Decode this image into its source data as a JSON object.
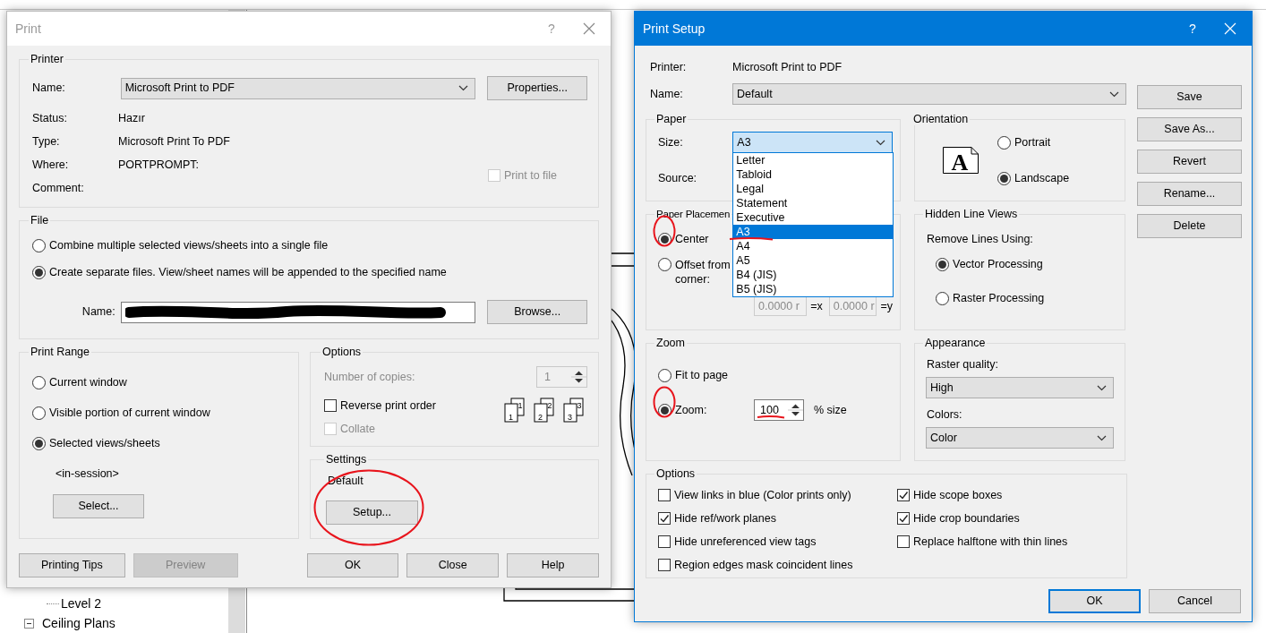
{
  "project_browser": {
    "items": [
      {
        "kind": "view",
        "label": "Level 2"
      },
      {
        "kind": "category",
        "label": "Ceiling Plans",
        "expanded": true
      }
    ]
  },
  "print_dialog": {
    "title": "Print",
    "active": false,
    "help_label": "?",
    "printer": {
      "legend": "Printer",
      "name_label": "Name:",
      "name_value": "Microsoft Print to PDF",
      "properties_button": "Properties...",
      "info": [
        {
          "label": "Status:",
          "value": "Hazır"
        },
        {
          "label": "Type:",
          "value": "Microsoft Print To PDF"
        },
        {
          "label": "Where:",
          "value": "PORTPROMPT:"
        },
        {
          "label": "Comment:"
        }
      ],
      "print_to_file": {
        "label": "Print to file",
        "checked": false,
        "disabled": true
      }
    },
    "file": {
      "legend": "File",
      "options": [
        {
          "label": "Combine multiple selected views/sheets into a single file",
          "selected": false
        },
        {
          "label": "Create separate files. View/sheet names will be appended to the specified name",
          "selected": true
        }
      ],
      "name_label": "Name:",
      "name_redacted": true,
      "browse_button": "Browse..."
    },
    "print_range": {
      "legend": "Print Range",
      "options": [
        {
          "label": "Current window",
          "selected": false
        },
        {
          "label": "Visible portion of current window",
          "selected": false
        },
        {
          "label": "Selected views/sheets",
          "selected": true
        }
      ],
      "selection": "<in-session>",
      "select_button": "Select..."
    },
    "options": {
      "legend": "Options",
      "copies_label": "Number of copies:",
      "copies_value": "1",
      "copies_disabled": true,
      "checks": [
        {
          "label": "Reverse print order",
          "checked": false,
          "disabled": false
        },
        {
          "label": "Collate",
          "checked": false,
          "disabled": true
        }
      ],
      "collate_icons": [
        {
          "back": "1",
          "front": "1"
        },
        {
          "back": "2",
          "front": "2"
        },
        {
          "back": "3",
          "front": "3"
        }
      ]
    },
    "settings": {
      "legend": "Settings",
      "value": "Default",
      "setup_button": "Setup...",
      "circled": true
    },
    "buttons_left": [
      {
        "label": "Printing Tips",
        "disabled": false
      },
      {
        "label": "Preview",
        "disabled": true
      }
    ],
    "buttons_right": [
      {
        "label": "OK",
        "disabled": false
      },
      {
        "label": "Close",
        "disabled": false
      },
      {
        "label": "Help",
        "disabled": false
      }
    ]
  },
  "print_setup": {
    "title": "Print Setup",
    "active": true,
    "help_label": "?",
    "printer_label": "Printer:",
    "printer_value": "Microsoft Print to PDF",
    "name_label": "Name:",
    "name_value": "Default",
    "paper": {
      "legend": "Paper",
      "size_label": "Size:",
      "size_value": "A3",
      "size_focused": true,
      "source_label": "Source:",
      "size_list": {
        "open": true,
        "items": [
          {
            "label": "Letter",
            "selected": false,
            "underlined": false
          },
          {
            "label": "Tabloid",
            "selected": false,
            "underlined": false
          },
          {
            "label": "Legal",
            "selected": false,
            "underlined": false
          },
          {
            "label": "Statement",
            "selected": false,
            "underlined": false
          },
          {
            "label": "Executive",
            "selected": false,
            "underlined": false
          },
          {
            "label": "A3",
            "selected": true,
            "underlined": true
          },
          {
            "label": "A4",
            "selected": false,
            "underlined": false
          },
          {
            "label": "A5",
            "selected": false,
            "underlined": false
          },
          {
            "label": "B4 (JIS)",
            "selected": false,
            "underlined": false
          },
          {
            "label": "B5 (JIS)",
            "selected": false,
            "underlined": false
          }
        ]
      }
    },
    "orientation": {
      "legend": "Orientation",
      "icon_letter": "A",
      "options": [
        {
          "label": "Portrait",
          "selected": false
        },
        {
          "label": "Landscape",
          "selected": true
        }
      ]
    },
    "placement": {
      "legend": "Paper Placemen",
      "options": [
        {
          "label": "Center",
          "selected": true,
          "circled": true
        },
        {
          "label": "Offset from corner:",
          "selected": false,
          "circled": false
        }
      ],
      "offset_x": "0.0000 r",
      "x_suffix": "=x",
      "offset_y": "0.0000 r",
      "y_suffix": "=y",
      "offset_disabled": true
    },
    "hidden_lines": {
      "legend": "Hidden Line Views",
      "label": "Remove Lines Using:",
      "options": [
        {
          "label": "Vector Processing",
          "selected": true
        },
        {
          "label": "Raster Processing",
          "selected": false
        }
      ]
    },
    "zoom": {
      "legend": "Zoom",
      "options": [
        {
          "label": "Fit to page",
          "selected": false,
          "circled": false
        },
        {
          "label": "Zoom:",
          "selected": true,
          "circled": true
        }
      ],
      "zoom_value": "100",
      "value_underlined": true,
      "unit": "% size"
    },
    "appearance": {
      "legend": "Appearance",
      "raster_label": "Raster quality:",
      "raster_value": "High",
      "colors_label": "Colors:",
      "colors_value": "Color"
    },
    "options": {
      "legend": "Options",
      "items": [
        {
          "label": "View links in blue (Color prints only)",
          "checked": false
        },
        {
          "label": "Hide scope boxes",
          "checked": true
        },
        {
          "label": "Hide ref/work planes",
          "checked": true
        },
        {
          "label": "Hide crop boundaries",
          "checked": true
        },
        {
          "label": "Hide unreferenced view tags",
          "checked": false
        },
        {
          "label": "Replace halftone with thin lines",
          "checked": false
        },
        {
          "label": "Region edges mask coincident lines",
          "checked": false
        }
      ]
    },
    "side_buttons": [
      "Save",
      "Save As...",
      "Revert",
      "Rename...",
      "Delete"
    ],
    "footer_buttons": [
      {
        "label": "OK",
        "default": true
      },
      {
        "label": "Cancel",
        "default": false
      }
    ]
  }
}
